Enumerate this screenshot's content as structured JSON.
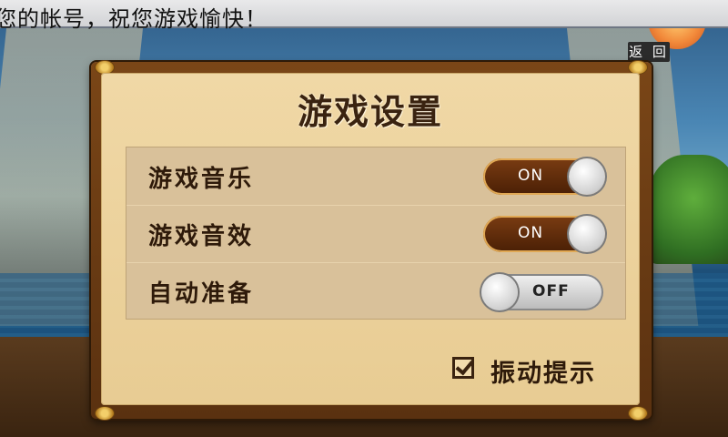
{
  "notice": {
    "text": "您的帐号，祝您游戏愉快！"
  },
  "back_button": {
    "label": "返 回"
  },
  "settings": {
    "title": "游戏设置",
    "rows": [
      {
        "label": "游戏音乐",
        "state": "ON"
      },
      {
        "label": "游戏音效",
        "state": "ON"
      },
      {
        "label": "自动准备",
        "state": "OFF"
      }
    ],
    "vibration": {
      "label": "振动提示",
      "checked": true
    }
  },
  "colors": {
    "panel": "#e8cc93",
    "frame": "#6a3a14",
    "toggle_on": "#5a2a0a",
    "toggle_off": "#d0d0d0"
  }
}
